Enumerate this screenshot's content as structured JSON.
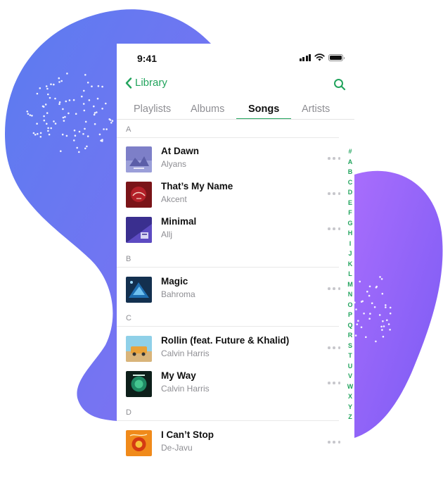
{
  "colors": {
    "accent": "#22a45d",
    "blob_left_start": "#5b7cf0",
    "blob_left_end": "#7f6ef4",
    "blob_right_start": "#a46cfb",
    "blob_right_end": "#7e5cf5",
    "secondary_text": "#8e8e93"
  },
  "status_bar": {
    "time": "9:41",
    "icons": [
      "signal-icon",
      "wifi-icon",
      "battery-icon"
    ]
  },
  "nav": {
    "back_label": "Library",
    "back_icon": "chevron-left-icon",
    "search_icon": "search-icon"
  },
  "tabs": [
    {
      "label": "Playlists",
      "active": false
    },
    {
      "label": "Albums",
      "active": false
    },
    {
      "label": "Songs",
      "active": true
    },
    {
      "label": "Artists",
      "active": false
    }
  ],
  "sections": [
    {
      "letter": "A",
      "songs": [
        {
          "title": "At Dawn",
          "artist": "Alyans",
          "art": "at-dawn-album-art"
        },
        {
          "title": "That’s My Name",
          "artist": "Akcent",
          "art": "thats-my-name-album-art"
        },
        {
          "title": "Minimal",
          "artist": "Allj",
          "art": "minimal-album-art"
        }
      ]
    },
    {
      "letter": "B",
      "songs": [
        {
          "title": "Magic",
          "artist": "Bahroma",
          "art": "magic-album-art"
        }
      ]
    },
    {
      "letter": "C",
      "songs": [
        {
          "title": "Rollin (feat. Future & Khalid)",
          "artist": "Calvin Harris",
          "art": "rollin-album-art"
        },
        {
          "title": "My Way",
          "artist": "Calvin Harris",
          "art": "my-way-album-art"
        }
      ]
    },
    {
      "letter": "D",
      "songs": [
        {
          "title": "I Can’t Stop",
          "artist": "De-Javu",
          "art": "i-cant-stop-album-art"
        }
      ]
    }
  ],
  "alpha_index": [
    "#",
    "A",
    "B",
    "C",
    "D",
    "E",
    "F",
    "G",
    "H",
    "I",
    "J",
    "K",
    "L",
    "M",
    "N",
    "O",
    "P",
    "Q",
    "R",
    "S",
    "T",
    "U",
    "V",
    "W",
    "X",
    "Y",
    "Z"
  ]
}
